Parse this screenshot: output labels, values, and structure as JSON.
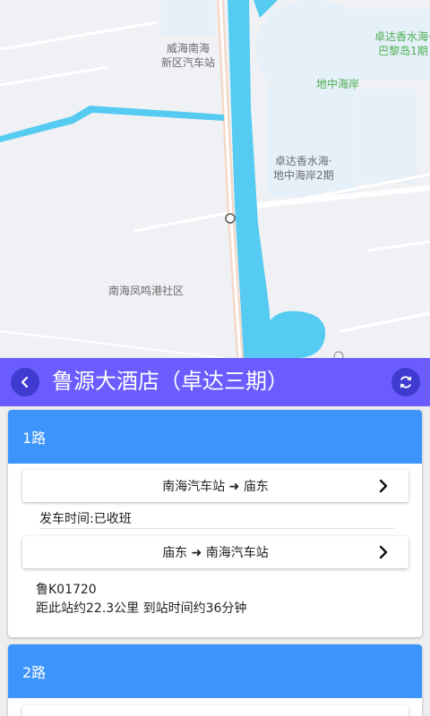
{
  "map": {
    "labels": {
      "weihai_station": "威海南海\n新区汽车站",
      "zhuoda_bali": "卓达香水海·\n巴黎岛1期",
      "dizhonghai": "地中海岸",
      "zhuoda_dizhonghai2": "卓达香水海·\n地中海岸2期",
      "nanhai_community": "南海凤鸣港社区"
    }
  },
  "header": {
    "title": "鲁源大酒店（卓达三期）"
  },
  "routes": [
    {
      "name": "1路",
      "directions": [
        {
          "label": "南海汽车站 ➜ 庙东"
        },
        {
          "label": "庙东 ➜ 南海汽车站"
        }
      ],
      "departure_status": "发车时间:已收班",
      "bus": {
        "plate": "鲁K01720",
        "distance_text": "距此站约22.3公里 到站时间约36分钟"
      }
    },
    {
      "name": "2路"
    }
  ],
  "colors": {
    "titlebar": "#6b5cff",
    "card_header": "#3d95fb",
    "water": "#55cbf1"
  }
}
